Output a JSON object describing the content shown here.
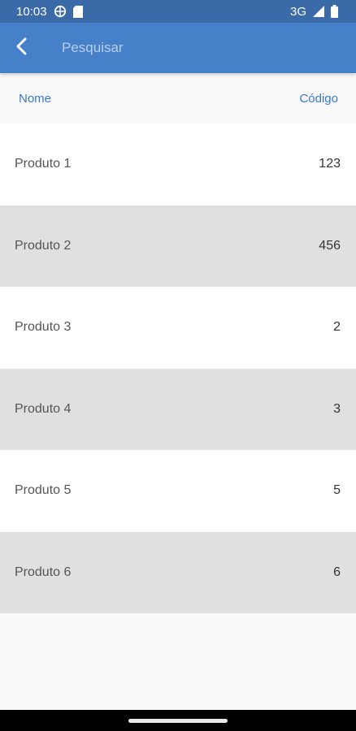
{
  "status_bar": {
    "time": "10:03",
    "network": "3G"
  },
  "app_bar": {
    "search_placeholder": "Pesquisar"
  },
  "table": {
    "headers": {
      "name": "Nome",
      "code": "Código"
    },
    "rows": [
      {
        "name": "Produto 1",
        "code": "123"
      },
      {
        "name": "Produto 2",
        "code": "456"
      },
      {
        "name": "Produto 3",
        "code": "2"
      },
      {
        "name": "Produto 4",
        "code": "3"
      },
      {
        "name": "Produto 5",
        "code": "5"
      },
      {
        "name": "Produto 6",
        "code": "6"
      }
    ]
  },
  "colors": {
    "status_bar": "#3a6ba8",
    "app_bar": "#4680c9",
    "header_text": "#3b78c4",
    "row_alt": "#e0e0e0"
  },
  "icons": {
    "back": "chevron-left-icon",
    "vpn": "globe-icon",
    "sim": "sim-card-icon",
    "signal": "signal-icon",
    "battery": "battery-icon"
  }
}
